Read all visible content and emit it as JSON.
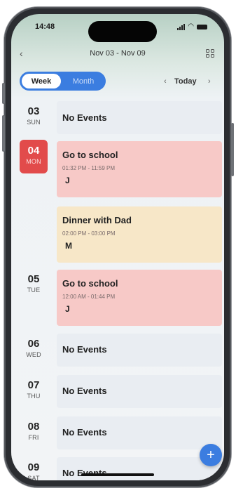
{
  "status": {
    "time": "14:48"
  },
  "nav": {
    "back": "‹",
    "title": "Nov 03 - Nov 09",
    "grid_icon": "grid-icon"
  },
  "view_toggle": {
    "week": "Week",
    "month": "Month"
  },
  "today_nav": {
    "prev": "‹",
    "label": "Today",
    "next": "›"
  },
  "days": [
    {
      "num": "03",
      "weekday": "SUN"
    },
    {
      "num": "04",
      "weekday": "MON"
    },
    {
      "num": "05",
      "weekday": "TUE"
    },
    {
      "num": "06",
      "weekday": "WED"
    },
    {
      "num": "07",
      "weekday": "THU"
    },
    {
      "num": "08",
      "weekday": "FRI"
    },
    {
      "num": "09",
      "weekday": "SAT"
    }
  ],
  "events": [
    {
      "title": "Go to school",
      "time": "01:32 PM - 11:59 PM",
      "avatar": "J"
    },
    {
      "title": "Dinner with Dad",
      "time": "02:00 PM - 03:00 PM",
      "avatar": "M"
    },
    {
      "title": "Go to school",
      "time": "12:00 AM - 01:44 PM",
      "avatar": "J"
    }
  ],
  "empty_label": "No Events",
  "fab": "+",
  "colors": {
    "accent": "#3b7de0",
    "selected_day": "#e24b4b",
    "school_event": "#f7c9c7",
    "dinner_event": "#f7e7c8"
  }
}
